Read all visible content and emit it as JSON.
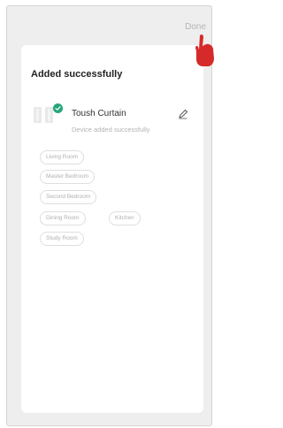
{
  "header": {
    "done_label": "Done"
  },
  "card": {
    "title": "Added successfully",
    "device": {
      "name": "Toush Curtain",
      "status": "Device added successfully",
      "icon": "curtain-icon",
      "badge_icon": "check-icon"
    },
    "edit_icon": "pencil-icon",
    "rooms": [
      "Living Room",
      "Master Bedroom",
      "Second Bedroom",
      "Dining Room",
      "Kitchen",
      "Study Room"
    ]
  },
  "colors": {
    "success_green": "#24a67a",
    "pointer_red": "#d62a2a",
    "background": "#eeeeee"
  }
}
